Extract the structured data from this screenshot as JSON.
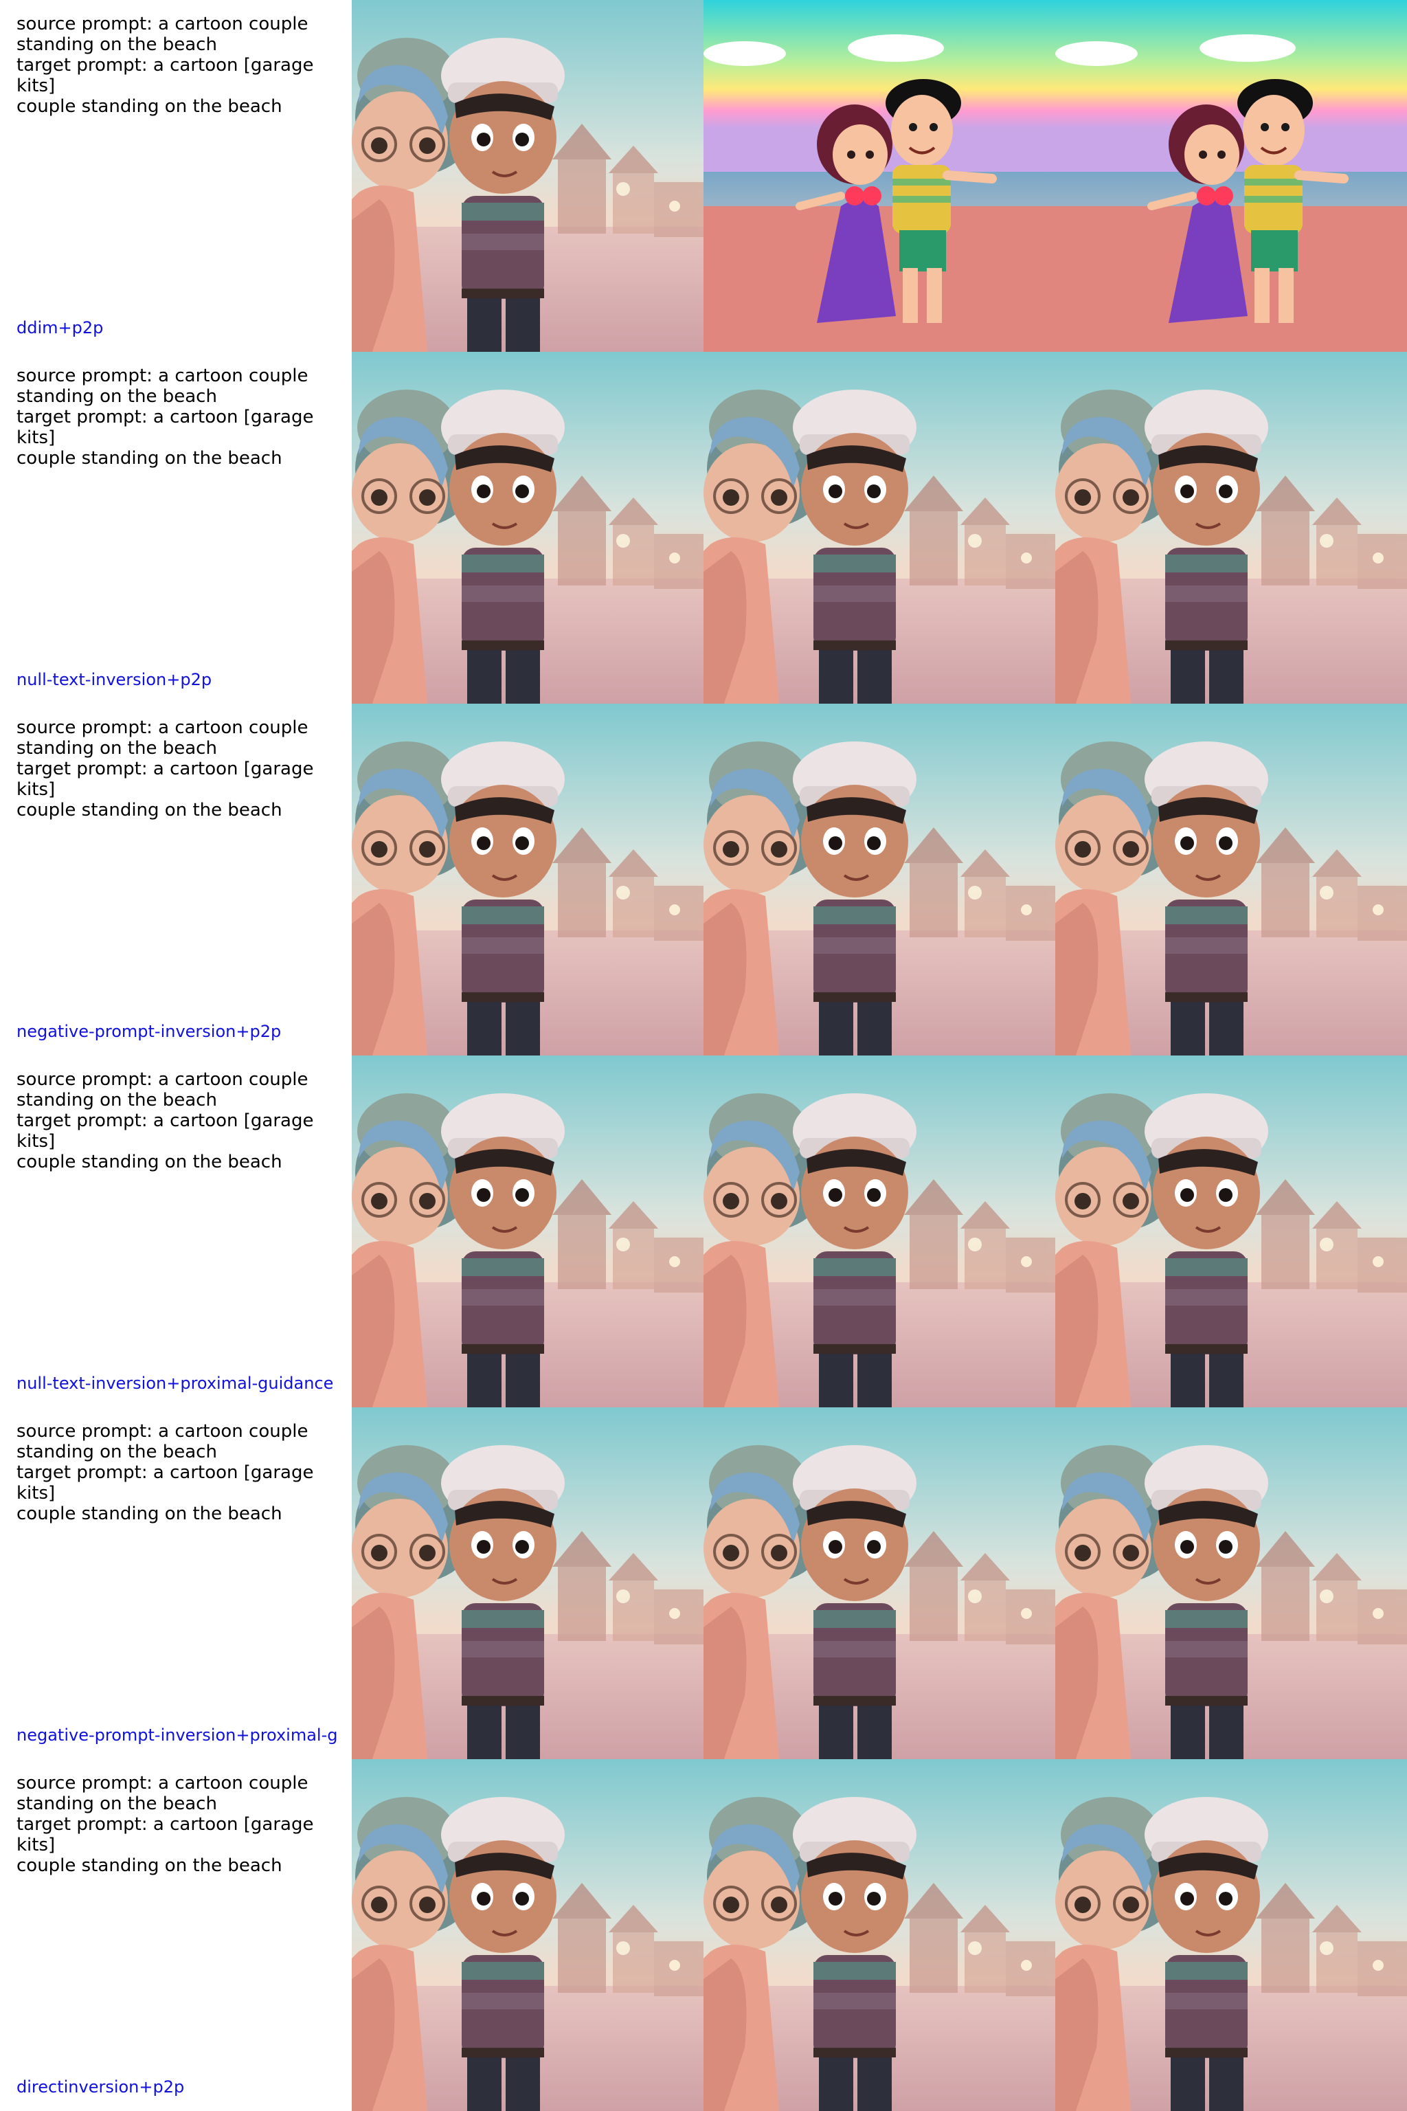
{
  "rows": [
    {
      "prompt_text": "source prompt: a cartoon couple\nstanding on the beach\ntarget prompt: a cartoon [garage kits]\ncouple standing on the beach",
      "method": "ddim+p2p"
    },
    {
      "prompt_text": "source prompt: a cartoon couple\nstanding on the beach\ntarget prompt: a cartoon [garage kits]\ncouple standing on the beach",
      "method": "null-text-inversion+p2p"
    },
    {
      "prompt_text": "source prompt: a cartoon couple\nstanding on the beach\ntarget prompt: a cartoon [garage kits]\ncouple standing on the beach",
      "method": "negative-prompt-inversion+p2p"
    },
    {
      "prompt_text": "source prompt: a cartoon couple\nstanding on the beach\ntarget prompt: a cartoon [garage kits]\ncouple standing on the beach",
      "method": "null-text-inversion+proximal-guidance"
    },
    {
      "prompt_text": "source prompt: a cartoon couple\nstanding on the beach\ntarget prompt: a cartoon [garage kits]\ncouple standing on the beach",
      "method": "negative-prompt-inversion+proximal-g"
    },
    {
      "prompt_text": "source prompt: a cartoon couple\nstanding on the beach\ntarget prompt: a cartoon [garage kits]\ncouple standing on the beach",
      "method": "directinversion+p2p"
    }
  ]
}
